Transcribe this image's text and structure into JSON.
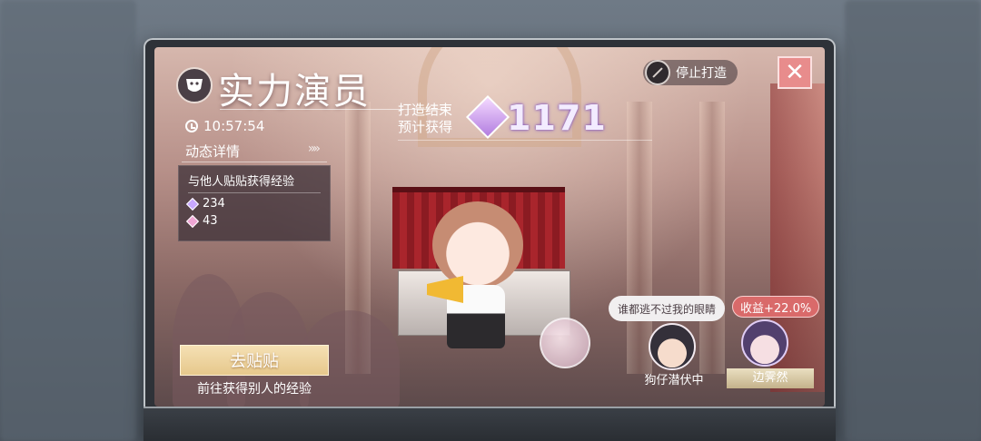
{
  "window": {
    "title": "实力演员",
    "stop_label": "停止打造",
    "close_symbol": "✕"
  },
  "header": {
    "timer": "10:57:54",
    "forecast_label_line1": "打造结束",
    "forecast_label_line2": "预计获得",
    "forecast_value": "1171"
  },
  "details": {
    "label": "动态详情",
    "chevrons": "»»",
    "panel_title": "与他人贴贴获得经验",
    "rows": [
      {
        "icon": "diamond-gem-icon",
        "color": "#c9a8ff",
        "value": "234"
      },
      {
        "icon": "pink-gem-icon",
        "color": "#f0a6d4",
        "value": "43"
      }
    ]
  },
  "action": {
    "button_label": "去贴贴",
    "description": "前往获得别人的经验"
  },
  "characters": {
    "speech": "谁都逃不过我的眼睛",
    "bonus": "收益+22.0%",
    "left_name": "狗仔潜伏中",
    "right_name": "边霁然"
  },
  "colors": {
    "accent_red": "#e88c8c",
    "gem_purple": "#b27de0",
    "gold_button": "#e6c88c"
  }
}
